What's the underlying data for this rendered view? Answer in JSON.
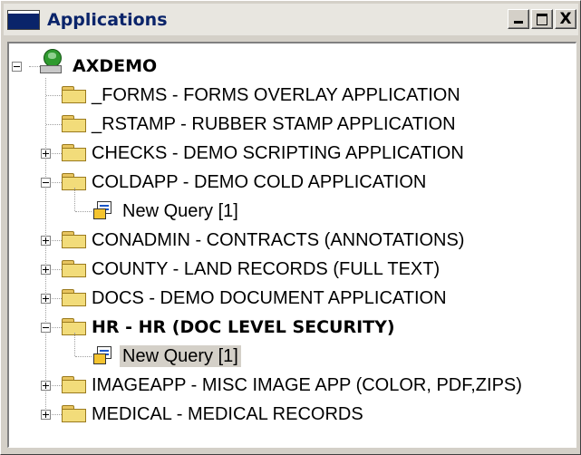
{
  "window": {
    "title": "Applications",
    "close_glyph": "X"
  },
  "tree": {
    "root": {
      "label": "AXDEMO",
      "icon": "server-globe-icon",
      "expanded": true
    },
    "items": [
      {
        "label": "_FORMS - FORMS OVERLAY APPLICATION",
        "icon": "folder-icon",
        "expander": "none"
      },
      {
        "label": "_RSTAMP - RUBBER STAMP APPLICATION",
        "icon": "folder-icon",
        "expander": "none"
      },
      {
        "label": "CHECKS - DEMO SCRIPTING APPLICATION",
        "icon": "folder-icon",
        "expander": "plus"
      },
      {
        "label": "COLDAPP - DEMO COLD APPLICATION",
        "icon": "folder-icon",
        "expander": "minus",
        "children": [
          {
            "label": "New Query [1]",
            "icon": "query-icon"
          }
        ]
      },
      {
        "label": "CONADMIN - CONTRACTS (ANNOTATIONS)",
        "icon": "folder-icon",
        "expander": "plus"
      },
      {
        "label": "COUNTY - LAND RECORDS (FULL TEXT)",
        "icon": "folder-icon",
        "expander": "plus"
      },
      {
        "label": "DOCS - DEMO DOCUMENT APPLICATION",
        "icon": "folder-icon",
        "expander": "plus"
      },
      {
        "label": "HR - HR (DOC LEVEL SECURITY)",
        "icon": "folder-icon",
        "expander": "minus",
        "bold": true,
        "children": [
          {
            "label": "New Query [1]",
            "icon": "query-icon",
            "selected": true
          }
        ]
      },
      {
        "label": "IMAGEAPP - MISC IMAGE APP (COLOR, PDF,ZIPS)",
        "icon": "folder-icon",
        "expander": "plus"
      },
      {
        "label": "MEDICAL - MEDICAL RECORDS",
        "icon": "folder-icon",
        "expander": "plus"
      }
    ]
  },
  "colors": {
    "title_text": "#0a246a",
    "selection_bg": "#d4d0c8",
    "folder": "#f2dc7a"
  }
}
